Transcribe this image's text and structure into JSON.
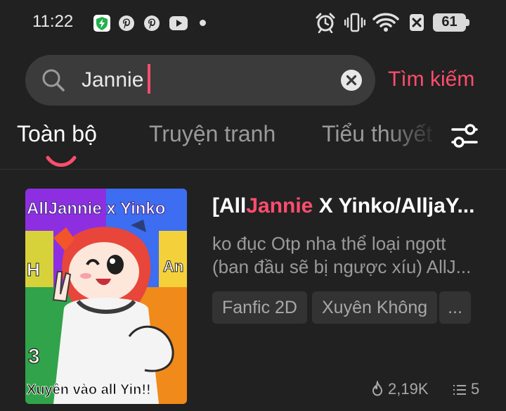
{
  "status_bar": {
    "time": "11:22",
    "battery": "61",
    "icons": [
      "shield-bolt-icon",
      "pinterest-icon",
      "pinterest-icon",
      "youtube-icon",
      "dot-icon",
      "alarm-icon",
      "vibrate-icon",
      "wifi-icon",
      "xbox-icon",
      "battery-icon"
    ]
  },
  "search": {
    "query": "Jannie",
    "submit_label": "Tìm kiếm"
  },
  "tabs": [
    {
      "label": "Toàn bộ",
      "active": true
    },
    {
      "label": "Truyện tranh",
      "active": false
    },
    {
      "label": "Tiểu thuyết",
      "active": false
    }
  ],
  "result": {
    "title_prefix": "[All",
    "title_highlight": "Jannie",
    "title_suffix": " X Yinko/AlljaY...",
    "description_line1": "ko đục Otp nha thể loại ngọtt",
    "description_line2": "(ban đầu sẽ bị ngược xíu) AllJ...",
    "tags": [
      "Fanfic 2D",
      "Xuyên Không",
      "..."
    ],
    "views": "2,19K",
    "chapters": "5",
    "cover": {
      "top_text": "AllJannie x Yinko",
      "bottom_text": "Xuyên vào all Yin!!"
    }
  },
  "colors": {
    "background": "#212121",
    "accent": "#ff4d6d",
    "search_background": "#3b3b3b",
    "tag_background": "#333333"
  }
}
